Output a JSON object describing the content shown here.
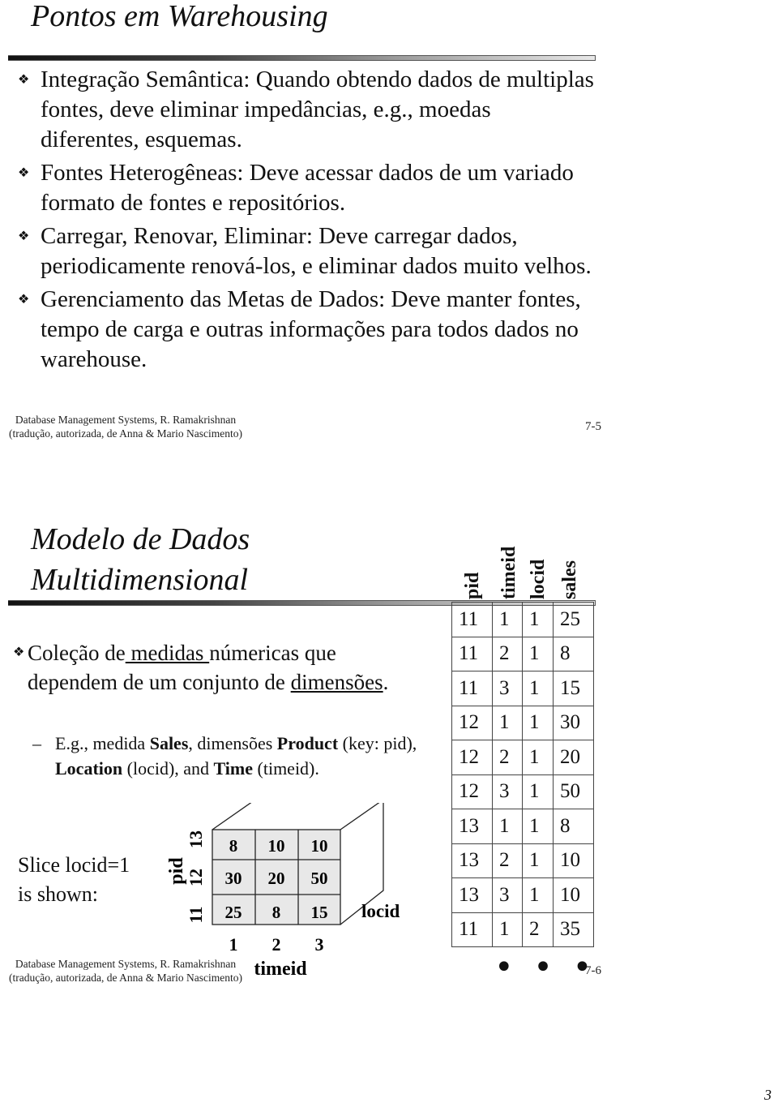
{
  "slide1": {
    "title": "Pontos em Warehousing",
    "bullets": [
      {
        "icon": "diamond-bullet-icon",
        "text": "Integração Semântica:  Quando obtendo dados de multiplas fontes, deve eliminar impedâncias, e.g., moedas diferentes, esquemas."
      },
      {
        "icon": "diamond-bullet-icon",
        "text": "Fontes Heterogêneas: Deve acessar dados de um variado formato de fontes e repositórios."
      },
      {
        "icon": "diamond-bullet-icon",
        "text": "Carregar, Renovar, Eliminar:  Deve carregar dados, periodicamente renová-los, e eliminar dados muito velhos."
      },
      {
        "icon": "diamond-bullet-icon",
        "text": "Gerenciamento das Metas  de Dados: Deve manter fontes, tempo de carga e outras informações para todos dados  no warehouse."
      }
    ],
    "footer_line1": "Database Management Systems, R. Ramakrishnan",
    "footer_line2": "(tradução, autorizada, de Anna & Mario Nascimento)",
    "slide_number": "7-5"
  },
  "slide2": {
    "title_line1": "Modelo de Dados",
    "title_line2": "Multidimensional",
    "bullet": {
      "part1": "Coleção de",
      "underlined1": " medidas ",
      "part2": "númericas que dependem de um conjunto de ",
      "underlined2": "dimensões",
      "part3": "."
    },
    "sub_bullet": {
      "dash": "–",
      "t1": "E.g., medida ",
      "b1": "Sales",
      "t2": ", dimensões ",
      "b2": "Product",
      "t3": " (key: pid), ",
      "b3": "Location",
      "t4": " (locid),   and ",
      "b4": "Time",
      "t5": " (timeid)."
    },
    "slice_caption_line1": "Slice locid=1",
    "slice_caption_line2": "is shown:",
    "cube": {
      "pid_label": "pid",
      "pid_ticks": [
        "13",
        "12",
        "11"
      ],
      "timeid_label": "timeid",
      "timeid_ticks": [
        "1",
        "2",
        "3"
      ],
      "locid_label": "locid",
      "cells": [
        [
          "8",
          "10",
          "10"
        ],
        [
          "30",
          "20",
          "50"
        ],
        [
          "25",
          "8",
          "15"
        ]
      ]
    },
    "table": {
      "columns": [
        "pid",
        "timeid",
        "locid",
        "sales"
      ],
      "rows": [
        [
          "11",
          "1",
          "1",
          "25"
        ],
        [
          "11",
          "2",
          "1",
          "8"
        ],
        [
          "11",
          "3",
          "1",
          "15"
        ],
        [
          "12",
          "1",
          "1",
          "30"
        ],
        [
          "12",
          "2",
          "1",
          "20"
        ],
        [
          "12",
          "3",
          "1",
          "50"
        ],
        [
          "13",
          "1",
          "1",
          "8"
        ],
        [
          "13",
          "2",
          "1",
          "10"
        ],
        [
          "13",
          "3",
          "1",
          "10"
        ],
        [
          "11",
          "1",
          "2",
          "35"
        ]
      ],
      "continuation": "• • •"
    },
    "footer_line1": "Database Management Systems, R. Ramakrishnan",
    "footer_line2": "(tradução, autorizada, de Anna & Mario Nascimento)",
    "slide_number": "7-6"
  },
  "page_number": "3"
}
